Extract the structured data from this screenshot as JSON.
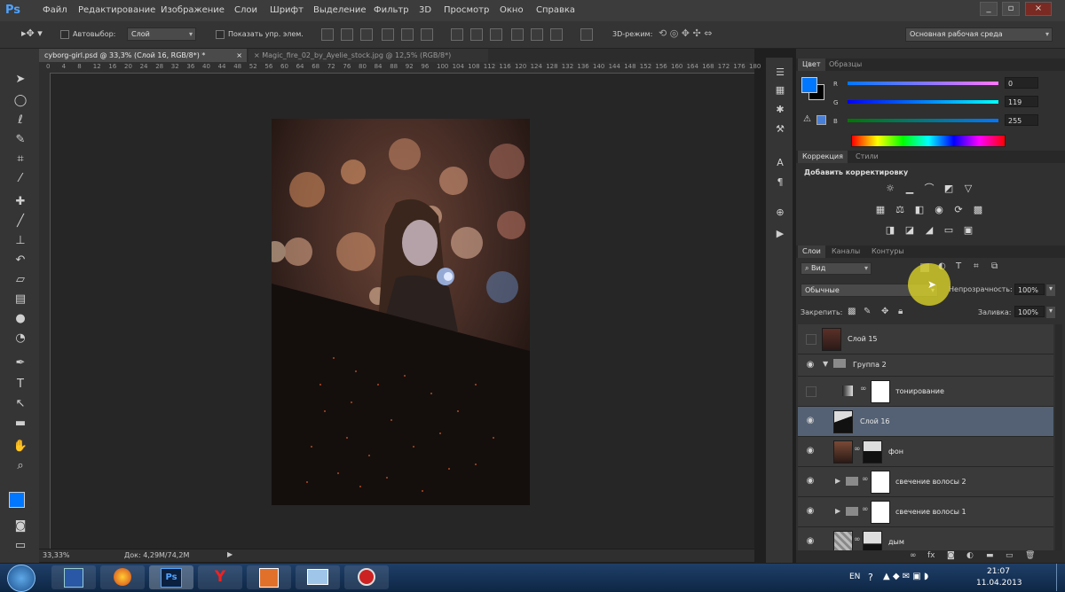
{
  "app": {
    "logo": "Ps"
  },
  "menu": [
    "Файл",
    "Редактирование",
    "Изображение",
    "Слои",
    "Шрифт",
    "Выделение",
    "Фильтр",
    "3D",
    "Просмотр",
    "Окно",
    "Справка"
  ],
  "window_controls": {
    "minimize": "_",
    "restore": "▫",
    "close": "×"
  },
  "options": {
    "autoselect_label": "Автовыбор:",
    "autoselect_value": "Слой",
    "show_transform_label": "Показать упр. элем.",
    "mode_3d_label": "3D-режим:",
    "workspace_value": "Основная рабочая среда"
  },
  "tabs": [
    {
      "label": "cyborg-girl.psd @ 33,3% (Слой 16, RGB/8*) *",
      "close": "×",
      "active": true
    },
    {
      "label": "Magic_fire_02_by_Ayelie_stock.jpg @ 12,5% (RGB/8*)",
      "close": "×",
      "active": false
    }
  ],
  "ruler_h": [
    "0",
    "2",
    "4",
    "6",
    "8",
    "10",
    "12",
    "14",
    "16",
    "18",
    "20",
    "22",
    "24",
    "26",
    "28",
    "30",
    "32",
    "34",
    "36",
    "38",
    "40",
    "42",
    "44",
    "46",
    "48",
    "50",
    "52",
    "54",
    "56",
    "58",
    "60",
    "62",
    "64",
    "66",
    "68",
    "70",
    "72",
    "74",
    "76",
    "78",
    "80",
    "82",
    "84",
    "86",
    "88",
    "90",
    "92",
    "94",
    "96",
    "98",
    "100",
    "102",
    "104",
    "106",
    "108",
    "110",
    "112",
    "114",
    "116",
    "118",
    "120",
    "122",
    "124",
    "126",
    "128",
    "130",
    "132",
    "134",
    "136",
    "138",
    "140",
    "142",
    "144",
    "146",
    "148",
    "150",
    "152",
    "154",
    "156",
    "158",
    "160",
    "162",
    "164",
    "166",
    "168",
    "170",
    "172",
    "174",
    "176",
    "178",
    "180"
  ],
  "status": {
    "zoom": "33,33%",
    "doc": "Док: 4,29M/74,2M"
  },
  "color_panel": {
    "tabs": [
      "Цвет",
      "Образцы"
    ],
    "channels": [
      {
        "label": "R",
        "value": "0"
      },
      {
        "label": "G",
        "value": "119"
      },
      {
        "label": "B",
        "value": "255"
      }
    ],
    "foreground": "#0077ff",
    "background": "#000000"
  },
  "adjustments": {
    "tabs": [
      "Коррекция",
      "Стили"
    ],
    "title": "Добавить корректировку"
  },
  "layers_panel": {
    "tabs": [
      "Слои",
      "Каналы",
      "Контуры"
    ],
    "filter_value": "Вид",
    "blend_mode": "Обычные",
    "opacity_label": "Непрозрачность:",
    "opacity_value": "100%",
    "lock_label": "Закрепить:",
    "fill_label": "Заливка:",
    "fill_value": "100%",
    "layers": [
      {
        "name": "Слой 15",
        "visible": false
      },
      {
        "name": "Группа 2",
        "visible": true
      },
      {
        "name": "тонирование",
        "visible": false
      },
      {
        "name": "Слой 16",
        "visible": true,
        "selected": true
      },
      {
        "name": "фон",
        "visible": true
      },
      {
        "name": "свечение волосы 2",
        "visible": true
      },
      {
        "name": "свечение волосы 1",
        "visible": true
      },
      {
        "name": "дым",
        "visible": true
      }
    ]
  },
  "taskbar": {
    "lang": "EN",
    "time": "21:07",
    "date": "11.04.2013",
    "ps_label": "Ps",
    "yandex_label": "Y"
  }
}
